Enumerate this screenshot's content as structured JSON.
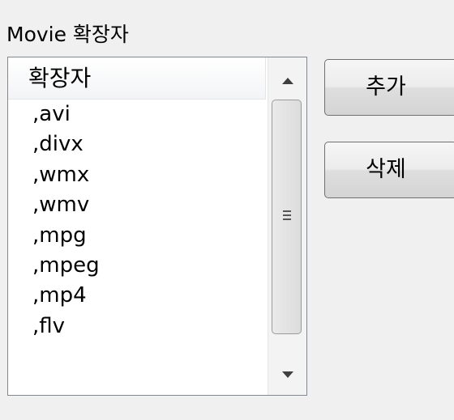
{
  "group": {
    "label": "Movie 확장자"
  },
  "listview": {
    "column_header": "확장자",
    "items": [
      ",avi",
      ",divx",
      ",wmx",
      ",wmv",
      ",mpg",
      ",mpeg",
      ",mp4",
      ",flv"
    ]
  },
  "buttons": {
    "add_label": "추가",
    "delete_label": "삭제"
  },
  "icons": {
    "scroll_up": "triangle-up-icon",
    "scroll_down": "triangle-down-icon",
    "thumb_grip": "grip-lines-icon"
  },
  "colors": {
    "window_bg": "#f0f0f0",
    "list_border": "#828790",
    "button_border": "#707070"
  }
}
